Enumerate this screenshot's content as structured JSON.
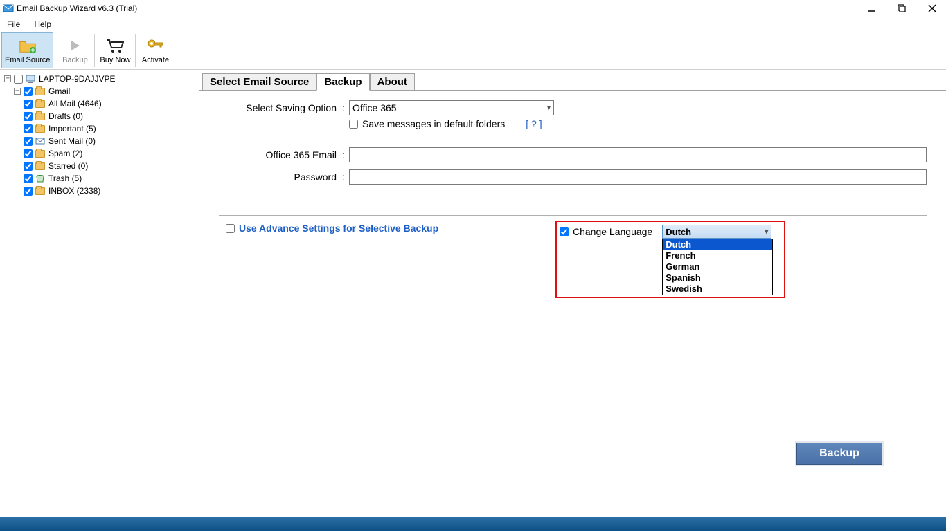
{
  "window": {
    "title": "Email Backup Wizard v6.3 (Trial)"
  },
  "menu": {
    "file": "File",
    "help": "Help"
  },
  "toolbar": {
    "email_source": "Email Source",
    "backup": "Backup",
    "buy_now": "Buy Now",
    "activate": "Activate"
  },
  "tree": {
    "root": "LAPTOP-9DAJJVPE",
    "gmail": "Gmail",
    "items": [
      "All Mail (4646)",
      "Drafts (0)",
      "Important (5)",
      "Sent Mail (0)",
      "Spam (2)",
      "Starred (0)",
      "Trash (5)",
      "INBOX (2338)"
    ]
  },
  "tabs": {
    "select": "Select Email Source",
    "backup": "Backup",
    "about": "About"
  },
  "form": {
    "saving_label": "Select Saving Option",
    "colon": ":",
    "saving_value": "Office 365",
    "default_folders": "Save messages in default folders",
    "help": "[ ? ]",
    "change_lang": "Change Language",
    "lang_selected": "Dutch",
    "lang_options": [
      "Dutch",
      "French",
      "German",
      "Spanish",
      "Swedish"
    ],
    "email_label": "Office 365 Email",
    "password_label": "Password",
    "advance": "Use Advance Settings for Selective Backup"
  },
  "buttons": {
    "backup": "Backup"
  }
}
